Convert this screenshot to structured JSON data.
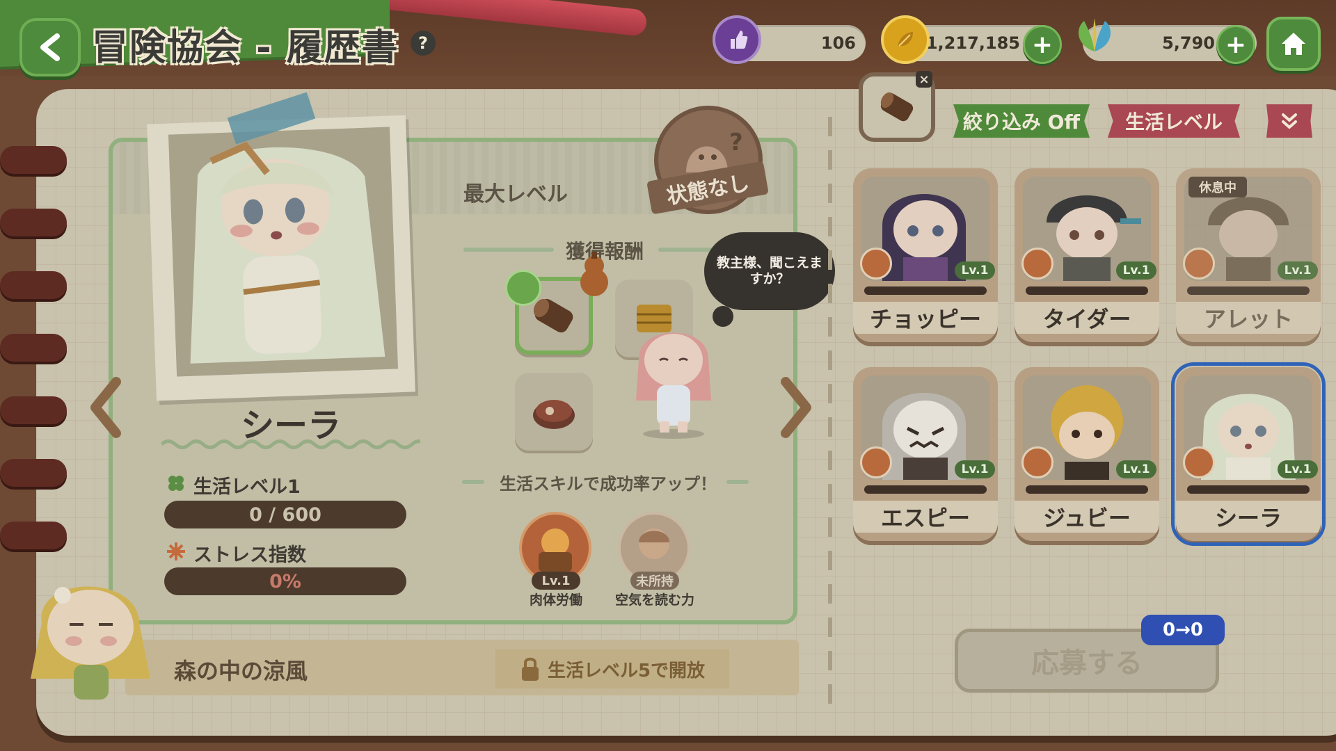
{
  "header": {
    "title": "冒険協会 - 履歴書",
    "help_icon": "?",
    "resources": {
      "stamina": "106",
      "gold": "1,217,185",
      "gems": "5,790"
    }
  },
  "profile": {
    "name": "シーラ",
    "life_level_label": "生活レベル1",
    "life_exp": "0 / 600",
    "stress_label": "ストレス指数",
    "stress_value": "0%"
  },
  "details": {
    "max_level": "最大レベル",
    "status_badge": "状態なし",
    "rewards_title": "獲得報酬",
    "skills_title": "生活スキルで成功率アップ！",
    "skills": [
      {
        "level": "Lv.1",
        "name": "肉体労働"
      },
      {
        "level": "未所持",
        "name": "空気を読む力"
      }
    ],
    "speech": "教主様、聞こえますか？"
  },
  "bottom": {
    "area_name": "森の中の涼風",
    "unlock_text": "生活レベル5で開放"
  },
  "filters": {
    "filter_toggle": "絞り込み Off",
    "sort_label": "生活レベル",
    "sort_arrow": "≫"
  },
  "characters": [
    {
      "name": "チョッピー",
      "level": "Lv.1",
      "resting": ""
    },
    {
      "name": "タイダー",
      "level": "Lv.1",
      "resting": ""
    },
    {
      "name": "アレット",
      "level": "Lv.1",
      "resting": "休息中"
    },
    {
      "name": "エスピー",
      "level": "Lv.1",
      "resting": ""
    },
    {
      "name": "ジュビー",
      "level": "Lv.1",
      "resting": ""
    },
    {
      "name": "シーラ",
      "level": "Lv.1",
      "resting": ""
    }
  ],
  "apply": {
    "label": "応募する",
    "counter": "0→0"
  }
}
